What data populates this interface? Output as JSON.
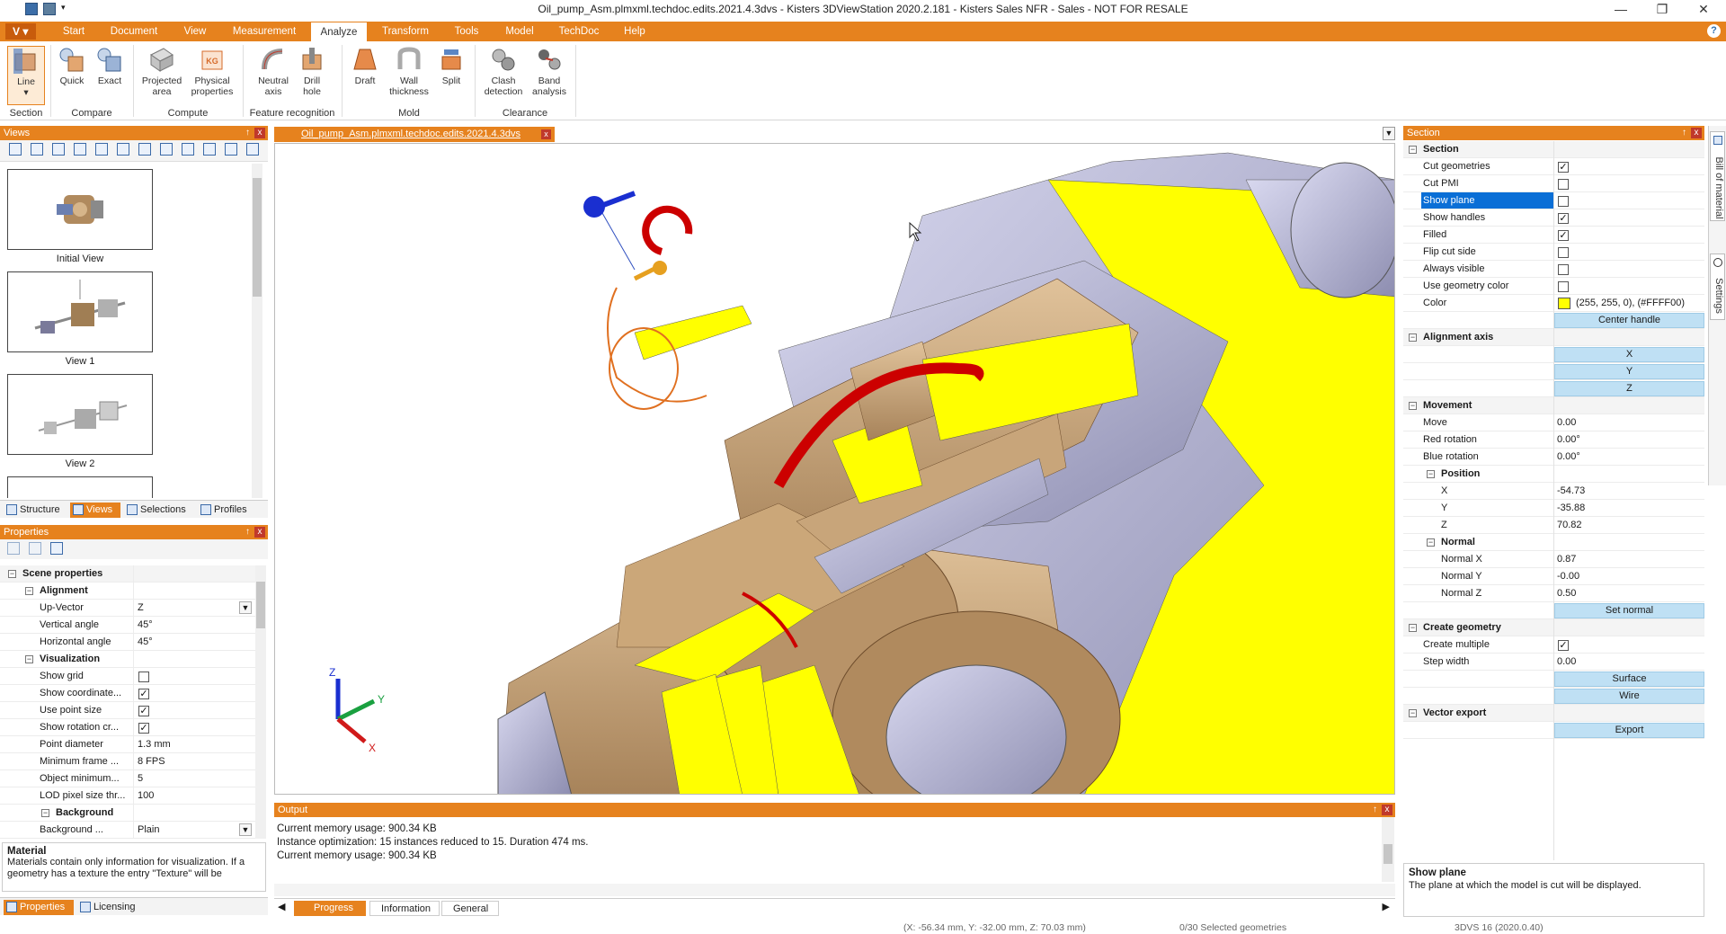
{
  "window": {
    "title": "Oil_pump_Asm.plmxml.techdoc.edits.2021.4.3dvs - Kisters 3DViewStation 2020.2.181 - Kisters Sales NFR - Sales - NOT FOR RESALE",
    "minimize": "—",
    "maximize": "❐",
    "close": "✕"
  },
  "menu": {
    "app": "V",
    "items": [
      "Start",
      "Document",
      "View",
      "Measurement",
      "Analyze",
      "Transform",
      "Tools",
      "Model",
      "TechDoc",
      "Help"
    ],
    "active": "Analyze",
    "help": "?"
  },
  "ribbon": {
    "buttons": [
      {
        "label": "Line",
        "sub": "▾"
      },
      {
        "label": "Quick"
      },
      {
        "label": "Exact"
      },
      {
        "label": "Projected",
        "label2": "area"
      },
      {
        "label": "Physical",
        "label2": "properties"
      },
      {
        "label": "Neutral",
        "label2": "axis"
      },
      {
        "label": "Drill",
        "label2": "hole"
      },
      {
        "label": "Draft"
      },
      {
        "label": "Wall",
        "label2": "thickness"
      },
      {
        "label": "Split"
      },
      {
        "label": "Clash",
        "label2": "detection"
      },
      {
        "label": "Band",
        "label2": "analysis"
      }
    ],
    "groups": [
      "Section",
      "Compare",
      "Compute",
      "Feature recognition",
      "Mold",
      "Clearance"
    ]
  },
  "views_panel": {
    "title": "Views",
    "pin": "↑",
    "close": "x",
    "thumbs": [
      "Initial View",
      "View 1",
      "View 2"
    ],
    "tabs": [
      "Structure",
      "Views",
      "Selections",
      "Profiles"
    ],
    "active_tab": "Views"
  },
  "properties_panel": {
    "title": "Properties",
    "pin": "↑",
    "close": "x",
    "rows": [
      {
        "k": "Scene properties",
        "type": "cat"
      },
      {
        "k": "Alignment",
        "type": "sub"
      },
      {
        "k": "Up-Vector",
        "v": "Z",
        "type": "dropdown"
      },
      {
        "k": "Vertical angle",
        "v": "45°"
      },
      {
        "k": "Horizontal angle",
        "v": "45°"
      },
      {
        "k": "Visualization",
        "type": "sub"
      },
      {
        "k": "Show grid",
        "type": "check",
        "checked": false
      },
      {
        "k": "Show coordinate...",
        "type": "check",
        "checked": true
      },
      {
        "k": "Use point size",
        "type": "check",
        "checked": true
      },
      {
        "k": "Show rotation cr...",
        "type": "check",
        "checked": true
      },
      {
        "k": "Point diameter",
        "v": "1.3 mm"
      },
      {
        "k": "Minimum frame ...",
        "v": "8 FPS"
      },
      {
        "k": "Object minimum...",
        "v": "5"
      },
      {
        "k": "LOD pixel size thr...",
        "v": "100"
      },
      {
        "k": "Background",
        "type": "sub2"
      },
      {
        "k": "Background ...",
        "v": "Plain",
        "type": "dropdown"
      }
    ],
    "help_title": "Material",
    "help_text": "Materials contain only information for visualization. If a geometry has a texture the entry \"Texture\" will be",
    "tabs": [
      "Properties",
      "Licensing"
    ],
    "active_tab": "Properties"
  },
  "document": {
    "tab": "Oil_pump_Asm.plmxml.techdoc.edits.2021.4.3dvs",
    "close": "x"
  },
  "triad": {
    "z": "Z",
    "y": "Y",
    "x": "X"
  },
  "output": {
    "title": "Output",
    "pin": "↑",
    "close": "x",
    "lines": [
      "Current memory usage: 900.34 KB",
      "Instance optimization: 15 instances reduced to 15. Duration 474 ms.",
      "Current memory usage: 900.34 KB"
    ],
    "tabs": [
      "Progress",
      "Information",
      "General"
    ],
    "active_tab": "Progress"
  },
  "section_panel": {
    "title": "Section",
    "pin": "↑",
    "close": "x",
    "rows": [
      {
        "k": "Section",
        "type": "cat"
      },
      {
        "k": "Cut geometries",
        "type": "check",
        "checked": true
      },
      {
        "k": "Cut PMI",
        "type": "check",
        "checked": false
      },
      {
        "k": "Show plane",
        "type": "check",
        "checked": false,
        "selected": true
      },
      {
        "k": "Show handles",
        "type": "check",
        "checked": true
      },
      {
        "k": "Filled",
        "type": "check",
        "checked": true
      },
      {
        "k": "Flip cut side",
        "type": "check",
        "checked": false
      },
      {
        "k": "Always visible",
        "type": "check",
        "checked": false
      },
      {
        "k": "Use geometry color",
        "type": "check",
        "checked": false
      },
      {
        "k": "Color",
        "v": "(255, 255, 0), (#FFFF00)",
        "type": "color",
        "color": "#FFFF00"
      },
      {
        "k": "",
        "v": "Center handle",
        "type": "button"
      },
      {
        "k": "Alignment axis",
        "type": "cat"
      },
      {
        "k": "",
        "v": "X",
        "type": "button"
      },
      {
        "k": "",
        "v": "Y",
        "type": "button"
      },
      {
        "k": "",
        "v": "Z",
        "type": "button"
      },
      {
        "k": "Movement",
        "type": "cat"
      },
      {
        "k": "Move",
        "v": "0.00"
      },
      {
        "k": "Red rotation",
        "v": "0.00°"
      },
      {
        "k": "Blue rotation",
        "v": "0.00°"
      },
      {
        "k": "Position",
        "type": "sub"
      },
      {
        "k": "X",
        "v": "-54.73",
        "type": "indent"
      },
      {
        "k": "Y",
        "v": "-35.88",
        "type": "indent"
      },
      {
        "k": "Z",
        "v": "70.82",
        "type": "indent"
      },
      {
        "k": "Normal",
        "type": "sub"
      },
      {
        "k": "Normal X",
        "v": "0.87",
        "type": "indent"
      },
      {
        "k": "Normal Y",
        "v": "-0.00",
        "type": "indent"
      },
      {
        "k": "Normal Z",
        "v": "0.50",
        "type": "indent"
      },
      {
        "k": "",
        "v": "Set normal",
        "type": "button"
      },
      {
        "k": "Create geometry",
        "type": "cat"
      },
      {
        "k": "Create multiple",
        "type": "check",
        "checked": true
      },
      {
        "k": "Step width",
        "v": "0.00"
      },
      {
        "k": "",
        "v": "Surface",
        "type": "button"
      },
      {
        "k": "",
        "v": "Wire",
        "type": "button"
      },
      {
        "k": "Vector export",
        "type": "cat"
      },
      {
        "k": "",
        "v": "Export",
        "type": "button"
      }
    ],
    "help_title": "Show plane",
    "help_text": "The plane at which the model is cut will be displayed."
  },
  "side_tabs": [
    "Bill of material",
    "Settings"
  ],
  "status": {
    "coords": "(X: -56.34 mm, Y: -32.00 mm, Z: 70.03 mm)",
    "selection": "0/30 Selected geometries",
    "version": "3DVS 16 (2020.0.40)"
  },
  "colors": {
    "accent": "#e6821e",
    "cut": "#ffff00",
    "part": "#c8a57a",
    "steel": "#a8a8c8",
    "select": "#0a6fd6"
  }
}
